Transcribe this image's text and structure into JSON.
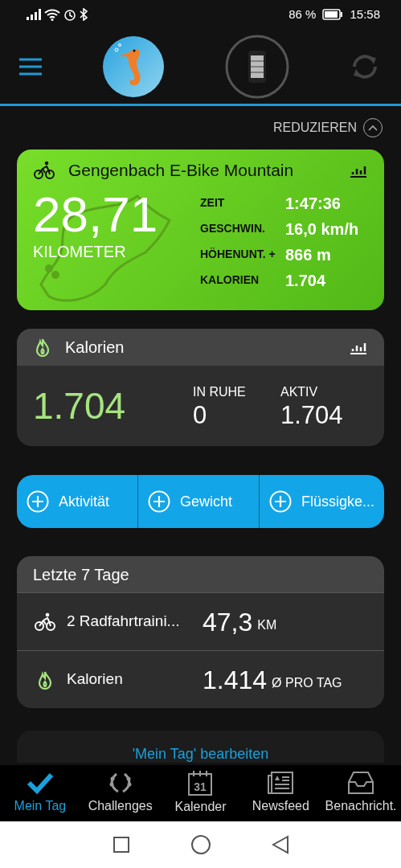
{
  "status_bar": {
    "battery_text": "86 %",
    "time": "15:58"
  },
  "header": {
    "sync_disabled": true
  },
  "collapse": {
    "label": "REDUZIEREN",
    "expanded": true
  },
  "activity": {
    "title": "Gengenbach E-Bike Mountain",
    "distance": "28,71",
    "distance_unit": "KILOMETER",
    "stats": [
      {
        "label": "ZEIT",
        "value": "1:47:36"
      },
      {
        "label": "GESCHWIN.",
        "value": "16,0 km/h"
      },
      {
        "label": "HÖHENUNT. +",
        "value": "866 m"
      },
      {
        "label": "KALORIEN",
        "value": "1.704"
      }
    ]
  },
  "calories": {
    "title": "Kalorien",
    "total": "1.704",
    "parts": [
      {
        "label": "IN RUHE",
        "value": "0"
      },
      {
        "label": "AKTIV",
        "value": "1.704"
      }
    ]
  },
  "add_buttons": [
    "Aktivität",
    "Gewicht",
    "Flüssigke..."
  ],
  "last7": {
    "title": "Letzte 7 Tage",
    "rows": [
      {
        "kind": "bike",
        "label": "2 Radfahrtraini...",
        "value": "47,3",
        "unit": "KM"
      },
      {
        "kind": "flame",
        "label": "Kalorien",
        "value": "1.414",
        "unit": "Ø PRO TAG"
      }
    ]
  },
  "edit_link": "'Mein Tag' bearbeiten",
  "tabs": [
    {
      "kind": "check",
      "label": "Mein Tag",
      "selected": true
    },
    {
      "kind": "laurel",
      "label": "Challenges",
      "selected": false
    },
    {
      "kind": "calendar",
      "label": "Kalender",
      "selected": false,
      "icon_label": "31"
    },
    {
      "kind": "news",
      "label": "Newsfeed",
      "selected": false
    },
    {
      "kind": "inbox",
      "label": "Benachricht.",
      "selected": false
    }
  ]
}
